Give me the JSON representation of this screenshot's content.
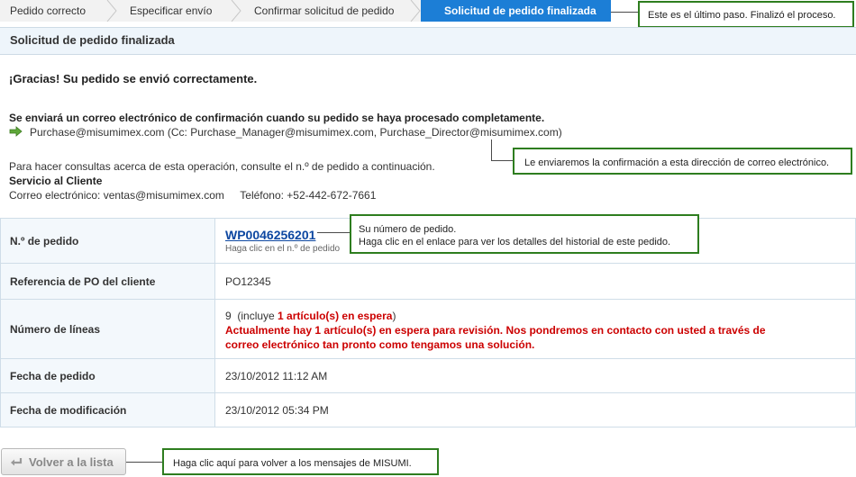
{
  "steps": [
    {
      "label": "Pedido correcto"
    },
    {
      "label": "Especificar envío"
    },
    {
      "label": "Confirmar solicitud de pedido"
    },
    {
      "label": "Solicitud de pedido finalizada"
    }
  ],
  "callouts": {
    "last_step": "Este es el último paso. Finalizó el proceso.",
    "email": "Le enviaremos la confirmación a esta dirección de correo electrónico.",
    "order_line1": "Su número de pedido.",
    "order_line2": "Haga clic en el enlace para ver los detalles del historial de este pedido.",
    "back": "Haga clic aquí para volver a los mensajes de MISUMI."
  },
  "page_title": "Solicitud de pedido finalizada",
  "thanks": "¡Gracias! Su pedido se envió correctamente.",
  "confirm_notice": "Se enviará un correo electrónico de confirmación cuando su pedido se haya procesado completamente.",
  "emails": "Purchase@misumimex.com (Cc: Purchase_Manager@misumimex.com, Purchase_Director@misumimex.com)",
  "contact": {
    "note": "Para hacer consultas acerca de esta operación, consulte el n.º de pedido a continuación.",
    "service_title": "Servicio al Cliente",
    "email_label": "Correo electrónico: ventas@misumimex.com",
    "phone_label": "Teléfono: +52-442-672-7661"
  },
  "details": {
    "order_no_label": "N.º de pedido",
    "order_no": "WP0046256201",
    "order_hint": "Haga clic en el n.º de pedido",
    "po_label": "Referencia de PO del cliente",
    "po_value": "PO12345",
    "lines_label": "Número de líneas",
    "lines_count": "9",
    "lines_incl_pre": "(incluye ",
    "lines_incl_red": "1 artículo(s) en espera",
    "lines_incl_post": ")",
    "lines_warning": "Actualmente hay 1 artículo(s) en espera para revisión. Nos pondremos en contacto con usted a través de correo electrónico tan pronto como tengamos una solución.",
    "order_date_label": "Fecha de pedido",
    "order_date": "23/10/2012 11:12 AM",
    "mod_date_label": "Fecha de modificación",
    "mod_date": "23/10/2012 05:34 PM"
  },
  "back_button": "Volver a la lista",
  "colors": {
    "accent": "#1c7ed6",
    "callout_border": "#2e7d1f",
    "warning": "#cc0000"
  }
}
